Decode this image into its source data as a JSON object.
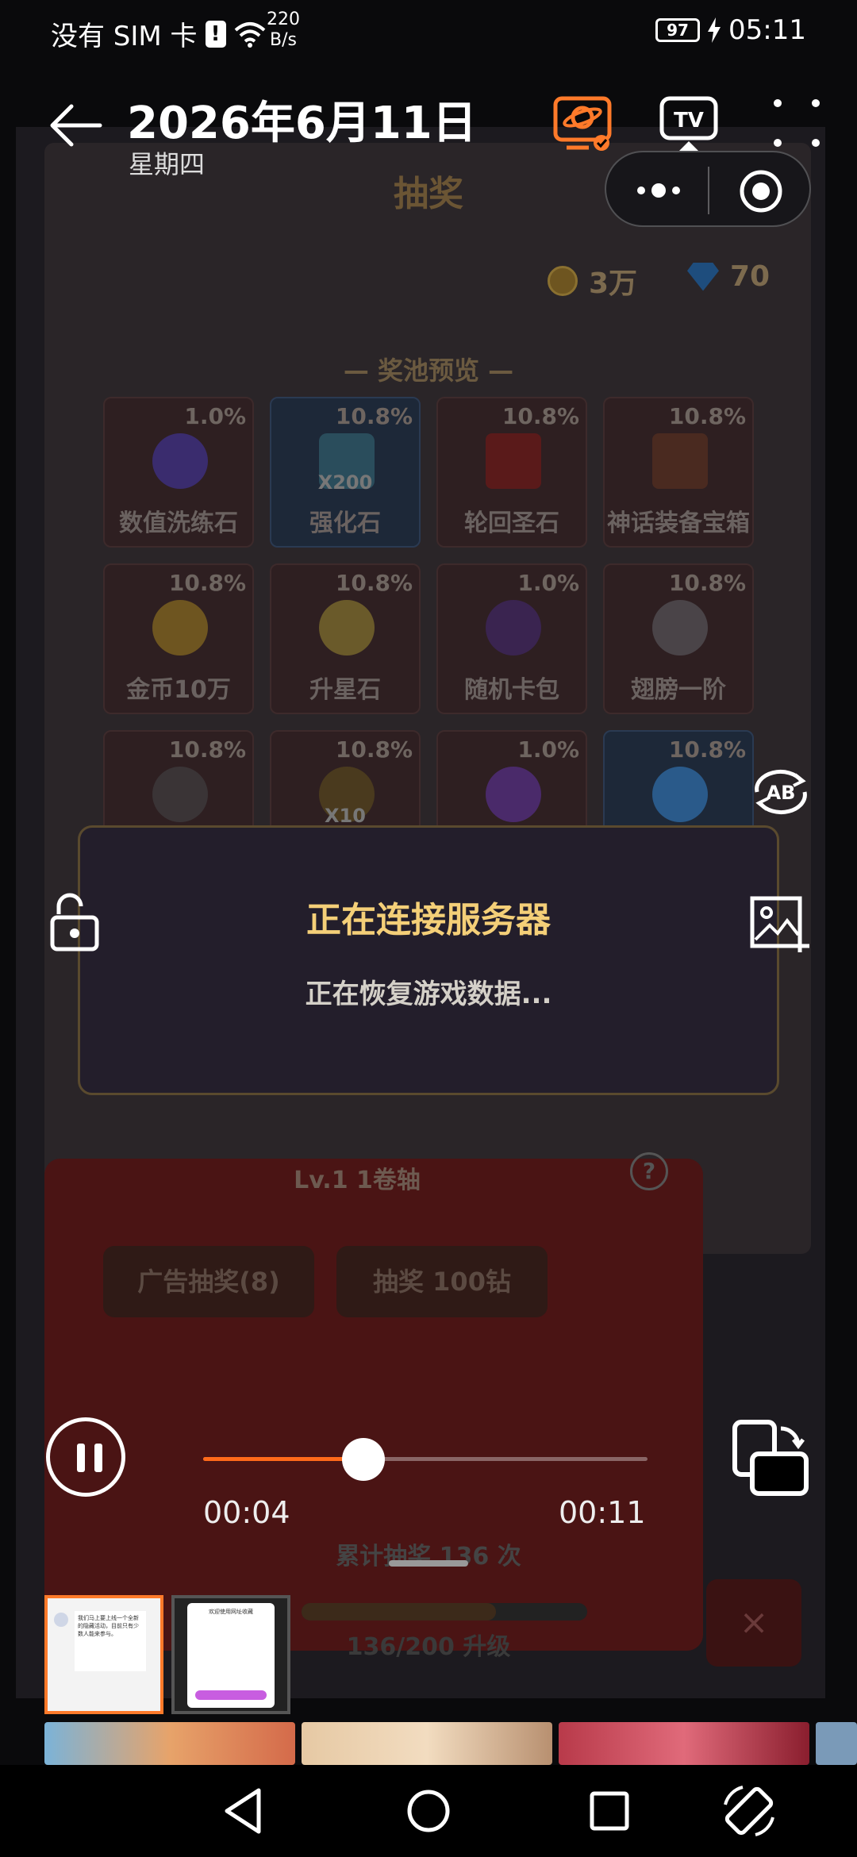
{
  "status_bar": {
    "carrier": "没有 SIM 卡",
    "sim_alert": "!",
    "net_speed_value": "220",
    "net_speed_unit": "B/s",
    "battery": "97",
    "time": "05:11"
  },
  "header": {
    "date": "2026年6月11日",
    "weekday": "星期四",
    "icons": [
      "back-arrow-icon",
      "planet-badge-icon",
      "tv-cast-icon",
      "more-dots-icon"
    ]
  },
  "capsule": {
    "icons": [
      "more-dots-icon",
      "record-circle-icon"
    ]
  },
  "game": {
    "title": "抽奖",
    "coins": "3万",
    "diamonds": "70",
    "pool_title": "— 奖池预览 —",
    "items": [
      {
        "name": "数值洗练石",
        "pct": "1.0%",
        "count": "",
        "color": "#3a2c6e"
      },
      {
        "name": "强化石",
        "pct": "10.8%",
        "count": "X200",
        "color": "#2a4d5c"
      },
      {
        "name": "轮回圣石",
        "pct": "10.8%",
        "count": "",
        "color": "#5a1a1a"
      },
      {
        "name": "神话装备宝箱",
        "pct": "10.8%",
        "count": "",
        "color": "#4a2a20"
      },
      {
        "name": "金币10万",
        "pct": "10.8%",
        "count": "",
        "color": "#6e5520"
      },
      {
        "name": "升星石",
        "pct": "10.8%",
        "count": "",
        "color": "#6a5a2a"
      },
      {
        "name": "随机卡包",
        "pct": "1.0%",
        "count": "",
        "color": "#3a2450"
      },
      {
        "name": "翅膀一阶",
        "pct": "10.8%",
        "count": "",
        "color": "#4a4448"
      },
      {
        "name": "",
        "pct": "10.8%",
        "count": "",
        "color": "#3a3436"
      },
      {
        "name": "",
        "pct": "10.8%",
        "count": "X10",
        "color": "#4a3a1e"
      },
      {
        "name": "",
        "pct": "1.0%",
        "count": "",
        "color": "#4a2a6a"
      },
      {
        "name": "",
        "pct": "10.8%",
        "count": "",
        "color": "#2a5a8a"
      }
    ],
    "level_text": "Lv.1  1卷轴",
    "help": "?",
    "ad_button": "广告抽奖(8)",
    "draw_button": "抽奖 100钻",
    "total_draws": "累计抽奖 136 次",
    "level_progress": "136/200 升级",
    "level_fraction": 0.68,
    "close": "×"
  },
  "dialog": {
    "title": "正在连接服务器",
    "message": "正在恢复游戏数据..."
  },
  "overlay_icons": [
    "unlock-icon",
    "ab-loop-icon",
    "crop-image-icon"
  ],
  "player": {
    "current_time": "00:04",
    "duration": "00:11",
    "progress": 0.36
  },
  "thumbnails": {
    "thumb1_text": "我们马上要上线一个全新的隐藏活动，目前只有少数人能来参与。",
    "thumb2_title": "欢迎使用网址收藏"
  },
  "navbar": {
    "icons": [
      "back-triangle-icon",
      "home-circle-icon",
      "recents-square-icon",
      "rotate-screen-icon"
    ]
  },
  "colors": {
    "accent": "#ff6a1a",
    "dialog_title": "#f4cf78",
    "dialog_bg": "#231e2b"
  }
}
